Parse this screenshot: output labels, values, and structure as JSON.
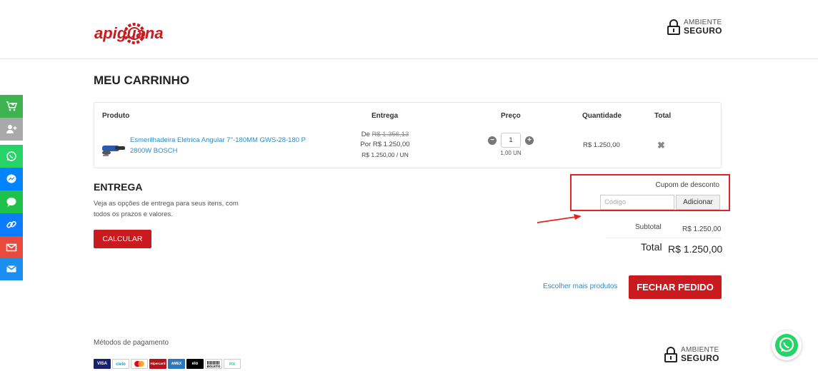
{
  "header": {
    "brand": "apiguana",
    "secure_line1": "AMBIENTE",
    "secure_line2": "SEGURO"
  },
  "page_title": "MEU CARRINHO",
  "cart": {
    "columns": {
      "product": "Produto",
      "delivery": "Entrega",
      "price": "Preço",
      "quantity": "Quantidade",
      "total": "Total"
    },
    "item": {
      "name": "Esmerilhadeira Eletrica Angular 7''-180MM GWS-28-180 P 2800W BOSCH",
      "from_label": "De",
      "old_price": "R$ 1.356,13",
      "price_line": "Por R$ 1.250,00",
      "unit_price": "R$ 1.250,00 / UN",
      "quantity": "1",
      "quantity_unit": "1,00 UN",
      "row_price": "R$ 1.250,00",
      "remove_icon": "close-icon"
    }
  },
  "shipping": {
    "title": "ENTREGA",
    "description": "Veja as opções de entrega para seus itens, com todos os prazos e valores.",
    "button": "CALCULAR"
  },
  "coupon": {
    "label": "Cupom de desconto",
    "placeholder": "Código",
    "button": "Adicionar"
  },
  "summary": {
    "subtotal_label": "Subtotal",
    "subtotal_value": "R$ 1.250,00",
    "total_label": "Total",
    "total_value": "R$ 1.250,00"
  },
  "actions": {
    "more_products": "Escolher mais produtos",
    "checkout": "FECHAR PEDIDO"
  },
  "footer": {
    "payment_title": "Métodos de pagamento",
    "secure_line1": "AMBIENTE",
    "secure_line2": "SEGURO",
    "payment_methods": [
      {
        "label": "VISA",
        "color": "#1a1f71"
      },
      {
        "label": "cielo",
        "color": "#00a5e0"
      },
      {
        "label": "mastercard",
        "color": "#eb001b"
      },
      {
        "label": "Hipercard",
        "color": "#b3131b"
      },
      {
        "label": "AMEX",
        "color": "#2e77bc"
      },
      {
        "label": "elo",
        "color": "#000000"
      },
      {
        "label": "BOLETO",
        "color": "#ffffff"
      },
      {
        "label": "PIX",
        "color": "#32bcad"
      }
    ]
  },
  "sidebar": [
    {
      "name": "cart-add-icon",
      "color": "#3fb34f"
    },
    {
      "name": "user-add-icon",
      "color": "#a9a9a9"
    },
    {
      "name": "whatsapp-icon",
      "color": "#25d366"
    },
    {
      "name": "messenger-icon",
      "color": "#0084ff"
    },
    {
      "name": "chat-icon",
      "color": "#1ec24a"
    },
    {
      "name": "link-icon",
      "color": "#0a7cff"
    },
    {
      "name": "mail-icon",
      "color": "#e94a3e"
    },
    {
      "name": "envelope-icon",
      "color": "#1b8ff0"
    }
  ],
  "colors": {
    "accent": "#c91b1f",
    "link": "#2f8bc9",
    "highlight": "#e32222"
  }
}
